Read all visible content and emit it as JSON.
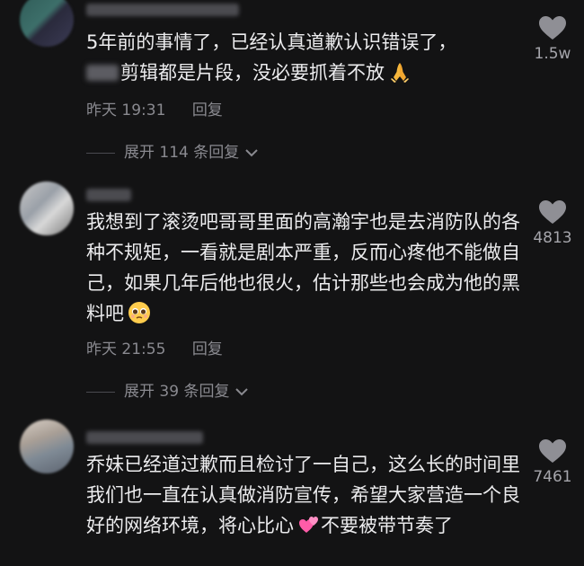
{
  "comments": [
    {
      "text_line1": "5年前的事情了，已经认真道歉认识错误了，",
      "text_line2": "剪辑都是片段，没必要抓着不放",
      "time": "昨天 19:31",
      "reply": "回复",
      "likes": "1.5w",
      "expand": "展开 114 条回复"
    },
    {
      "text": "我想到了滚烫吧哥哥里面的高瀚宇也是去消防队的各种不规矩，一看就是剧本严重，反而心疼他不能做自己，如果几年后他也很火，估计那些也会成为他的黑料吧",
      "time": "昨天 21:55",
      "reply": "回复",
      "likes": "4813",
      "expand": "展开 39 条回复"
    },
    {
      "text_part1": "乔妹已经道过歉而且检讨了一自己，这么长的时间里我们也一直在认真做消防宣传，希望大家营造一个良好的网络环境，将心比心",
      "text_part2": "不要被带节奏了",
      "likes": "7461"
    }
  ],
  "icons": {
    "like": "heart-icon",
    "expand": "chevron-down-icon",
    "emoji1": "folded-hands-emoji",
    "emoji2": "pleading-face-emoji",
    "emoji3": "two-hearts-emoji"
  },
  "colors": {
    "background": "#131314",
    "text": "#ececee",
    "muted": "#8a8a90"
  }
}
